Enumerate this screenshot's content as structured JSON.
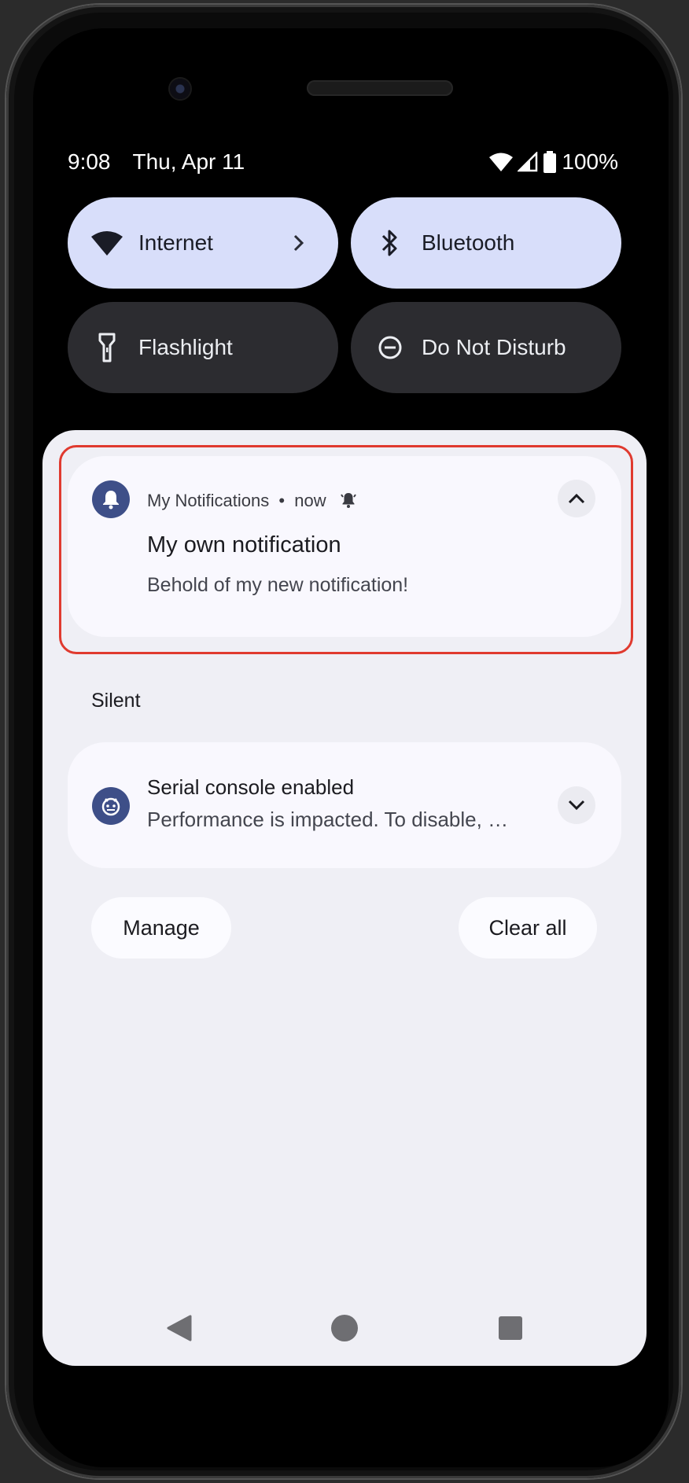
{
  "status_bar": {
    "time": "9:08",
    "date": "Thu, Apr 11",
    "battery": "100%"
  },
  "quick_tiles": [
    {
      "label": "Internet",
      "icon": "wifi-icon",
      "state": "on",
      "has_chevron": true
    },
    {
      "label": "Bluetooth",
      "icon": "bluetooth-icon",
      "state": "on"
    },
    {
      "label": "Flashlight",
      "icon": "flashlight-icon",
      "state": "off"
    },
    {
      "label": "Do Not Disturb",
      "icon": "do-not-disturb-icon",
      "state": "off"
    }
  ],
  "notification": {
    "app_name": "My Notifications",
    "separator": "•",
    "time": "now",
    "title": "My own notification",
    "body": "Behold of my new notification!"
  },
  "silent_section": {
    "header": "Silent",
    "notification": {
      "title": "Serial console enabled",
      "body": "Performance is impacted. To disable, …"
    }
  },
  "actions": {
    "manage": "Manage",
    "clear_all": "Clear all"
  },
  "colors": {
    "tile_on": "#d8defa",
    "tile_off": "#2c2c30",
    "app_icon": "#3e4f88",
    "highlight": "#e03a2f"
  }
}
